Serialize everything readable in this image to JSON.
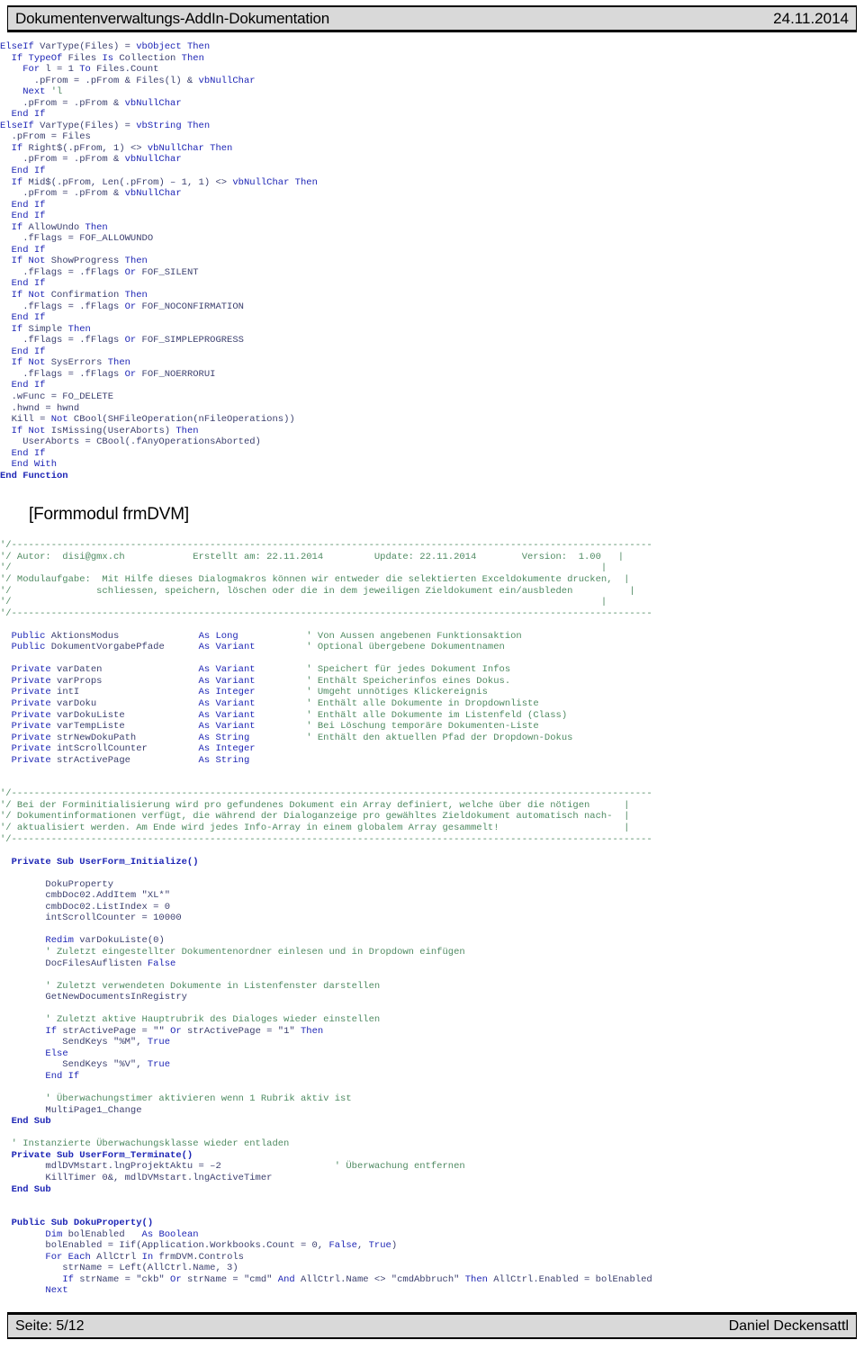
{
  "header": {
    "title": "Dokumentenverwaltungs-AddIn-Dokumentation",
    "date": "24.11.2014"
  },
  "footer": {
    "page_label": "Seite: 5/12",
    "author": "Daniel Deckensattl"
  },
  "section_title": "[Formmodul frmDVM]",
  "colors": {
    "keyword": "#1d25b5",
    "comment": "#4f8a62",
    "plain": "#3b3f6e",
    "chrome": "#d9d9d9"
  },
  "code_top": [
    {
      "t": "kw",
      "s": "ElseIf"
    },
    {
      "t": "pl",
      "s": " VarType(Files) = "
    },
    {
      "t": "kw",
      "s": "vbObject Then"
    },
    {
      "t": "nl"
    },
    {
      "t": "pl",
      "s": "  "
    },
    {
      "t": "kw",
      "s": "If TypeOf"
    },
    {
      "t": "pl",
      "s": " Files "
    },
    {
      "t": "kw",
      "s": "Is"
    },
    {
      "t": "pl",
      "s": " Collection "
    },
    {
      "t": "kw",
      "s": "Then"
    },
    {
      "t": "nl"
    },
    {
      "t": "pl",
      "s": "    "
    },
    {
      "t": "kw",
      "s": "For"
    },
    {
      "t": "pl",
      "s": " l = 1 "
    },
    {
      "t": "kw",
      "s": "To"
    },
    {
      "t": "pl",
      "s": " Files.Count"
    },
    {
      "t": "nl"
    },
    {
      "t": "pl",
      "s": "      .pFrom = .pFrom & Files(l) & "
    },
    {
      "t": "kw",
      "s": "vbNullChar"
    },
    {
      "t": "nl"
    },
    {
      "t": "pl",
      "s": "    "
    },
    {
      "t": "kw",
      "s": "Next"
    },
    {
      "t": "cm",
      "s": " 'l"
    },
    {
      "t": "nl"
    },
    {
      "t": "pl",
      "s": "    .pFrom = .pFrom & "
    },
    {
      "t": "kw",
      "s": "vbNullChar"
    },
    {
      "t": "nl"
    },
    {
      "t": "pl",
      "s": "  "
    },
    {
      "t": "kw",
      "s": "End If"
    },
    {
      "t": "nl"
    },
    {
      "t": "kw",
      "s": "ElseIf"
    },
    {
      "t": "pl",
      "s": " VarType(Files) = "
    },
    {
      "t": "kw",
      "s": "vbString Then"
    },
    {
      "t": "nl"
    },
    {
      "t": "pl",
      "s": "  .pFrom = Files"
    },
    {
      "t": "nl"
    },
    {
      "t": "pl",
      "s": "  "
    },
    {
      "t": "kw",
      "s": "If"
    },
    {
      "t": "pl",
      "s": " Right$(.pFrom, 1) <> "
    },
    {
      "t": "kw",
      "s": "vbNullChar Then"
    },
    {
      "t": "nl"
    },
    {
      "t": "pl",
      "s": "    .pFrom = .pFrom & "
    },
    {
      "t": "kw",
      "s": "vbNullChar"
    },
    {
      "t": "nl"
    },
    {
      "t": "pl",
      "s": "  "
    },
    {
      "t": "kw",
      "s": "End If"
    },
    {
      "t": "nl"
    },
    {
      "t": "pl",
      "s": "  "
    },
    {
      "t": "kw",
      "s": "If"
    },
    {
      "t": "pl",
      "s": " Mid$(.pFrom, Len(.pFrom) – 1, 1) <> "
    },
    {
      "t": "kw",
      "s": "vbNullChar Then"
    },
    {
      "t": "nl"
    },
    {
      "t": "pl",
      "s": "    .pFrom = .pFrom & "
    },
    {
      "t": "kw",
      "s": "vbNullChar"
    },
    {
      "t": "nl"
    },
    {
      "t": "pl",
      "s": "  "
    },
    {
      "t": "kw",
      "s": "End If"
    },
    {
      "t": "nl"
    },
    {
      "t": "pl",
      "s": "  "
    },
    {
      "t": "kw",
      "s": "End If"
    },
    {
      "t": "nl"
    },
    {
      "t": "pl",
      "s": "  "
    },
    {
      "t": "kw",
      "s": "If"
    },
    {
      "t": "pl",
      "s": " AllowUndo "
    },
    {
      "t": "kw",
      "s": "Then"
    },
    {
      "t": "nl"
    },
    {
      "t": "pl",
      "s": "    .fFlags = FOF_ALLOWUNDO"
    },
    {
      "t": "nl"
    },
    {
      "t": "pl",
      "s": "  "
    },
    {
      "t": "kw",
      "s": "End If"
    },
    {
      "t": "nl"
    },
    {
      "t": "pl",
      "s": "  "
    },
    {
      "t": "kw",
      "s": "If Not"
    },
    {
      "t": "pl",
      "s": " ShowProgress "
    },
    {
      "t": "kw",
      "s": "Then"
    },
    {
      "t": "nl"
    },
    {
      "t": "pl",
      "s": "    .fFlags = .fFlags "
    },
    {
      "t": "kw",
      "s": "Or"
    },
    {
      "t": "pl",
      "s": " FOF_SILENT"
    },
    {
      "t": "nl"
    },
    {
      "t": "pl",
      "s": "  "
    },
    {
      "t": "kw",
      "s": "End If"
    },
    {
      "t": "nl"
    },
    {
      "t": "pl",
      "s": "  "
    },
    {
      "t": "kw",
      "s": "If Not"
    },
    {
      "t": "pl",
      "s": " Confirmation "
    },
    {
      "t": "kw",
      "s": "Then"
    },
    {
      "t": "nl"
    },
    {
      "t": "pl",
      "s": "    .fFlags = .fFlags "
    },
    {
      "t": "kw",
      "s": "Or"
    },
    {
      "t": "pl",
      "s": " FOF_NOCONFIRMATION"
    },
    {
      "t": "nl"
    },
    {
      "t": "pl",
      "s": "  "
    },
    {
      "t": "kw",
      "s": "End If"
    },
    {
      "t": "nl"
    },
    {
      "t": "pl",
      "s": "  "
    },
    {
      "t": "kw",
      "s": "If"
    },
    {
      "t": "pl",
      "s": " Simple "
    },
    {
      "t": "kw",
      "s": "Then"
    },
    {
      "t": "nl"
    },
    {
      "t": "pl",
      "s": "    .fFlags = .fFlags "
    },
    {
      "t": "kw",
      "s": "Or"
    },
    {
      "t": "pl",
      "s": " FOF_SIMPLEPROGRESS"
    },
    {
      "t": "nl"
    },
    {
      "t": "pl",
      "s": "  "
    },
    {
      "t": "kw",
      "s": "End If"
    },
    {
      "t": "nl"
    },
    {
      "t": "pl",
      "s": "  "
    },
    {
      "t": "kw",
      "s": "If Not"
    },
    {
      "t": "pl",
      "s": " SysErrors "
    },
    {
      "t": "kw",
      "s": "Then"
    },
    {
      "t": "nl"
    },
    {
      "t": "pl",
      "s": "    .fFlags = .fFlags "
    },
    {
      "t": "kw",
      "s": "Or"
    },
    {
      "t": "pl",
      "s": " FOF_NOERRORUI"
    },
    {
      "t": "nl"
    },
    {
      "t": "pl",
      "s": "  "
    },
    {
      "t": "kw",
      "s": "End If"
    },
    {
      "t": "nl"
    },
    {
      "t": "pl",
      "s": "  .wFunc = FO_DELETE"
    },
    {
      "t": "nl"
    },
    {
      "t": "pl",
      "s": "  .hwnd = hwnd"
    },
    {
      "t": "nl"
    },
    {
      "t": "pl",
      "s": "  Kill = "
    },
    {
      "t": "kw",
      "s": "Not"
    },
    {
      "t": "pl",
      "s": " CBool(SHFileOperation(nFileOperations))"
    },
    {
      "t": "nl"
    },
    {
      "t": "pl",
      "s": "  "
    },
    {
      "t": "kw",
      "s": "If Not"
    },
    {
      "t": "pl",
      "s": " IsMissing(UserAborts) "
    },
    {
      "t": "kw",
      "s": "Then"
    },
    {
      "t": "nl"
    },
    {
      "t": "pl",
      "s": "    UserAborts = CBool(.fAnyOperationsAborted)"
    },
    {
      "t": "nl"
    },
    {
      "t": "pl",
      "s": "  "
    },
    {
      "t": "kw",
      "s": "End If"
    },
    {
      "t": "nl"
    },
    {
      "t": "pl",
      "s": "  "
    },
    {
      "t": "kw",
      "s": "End With"
    },
    {
      "t": "nl"
    },
    {
      "t": "bd",
      "s": "End Function"
    }
  ],
  "code_mid": [
    {
      "t": "cm",
      "s": "'/-----------------------------------------------------------------------------------------------------------------"
    },
    {
      "t": "nl"
    },
    {
      "t": "cm",
      "s": "'/ Autor:  disi@gmx.ch            Erstellt am: 22.11.2014         Update: 22.11.2014        Version:  1.00   |"
    },
    {
      "t": "nl"
    },
    {
      "t": "cm",
      "s": "'/                                                                                                        |"
    },
    {
      "t": "nl"
    },
    {
      "t": "cm",
      "s": "'/ Modulaufgabe:  Mit Hilfe dieses Dialogmakros können wir entweder die selektierten Exceldokumente drucken,  |"
    },
    {
      "t": "nl"
    },
    {
      "t": "cm",
      "s": "'/               schliessen, speichern, löschen oder die in dem jeweiligen Zieldokument ein/ausbleden          |"
    },
    {
      "t": "nl"
    },
    {
      "t": "cm",
      "s": "'/                                                                                                        |"
    },
    {
      "t": "nl"
    },
    {
      "t": "cm",
      "s": "'/-----------------------------------------------------------------------------------------------------------------"
    },
    {
      "t": "nl"
    },
    {
      "t": "nl"
    },
    {
      "t": "kw",
      "s": "  Public"
    },
    {
      "t": "pl",
      "s": " AktionsModus              "
    },
    {
      "t": "kw",
      "s": "As Long"
    },
    {
      "t": "pl",
      "s": "            "
    },
    {
      "t": "cm",
      "s": "' Von Aussen angebenen Funktionsaktion"
    },
    {
      "t": "nl"
    },
    {
      "t": "kw",
      "s": "  Public"
    },
    {
      "t": "pl",
      "s": " DokumentVorgabePfade      "
    },
    {
      "t": "kw",
      "s": "As Variant"
    },
    {
      "t": "pl",
      "s": "         "
    },
    {
      "t": "cm",
      "s": "' Optional übergebene Dokumentnamen"
    },
    {
      "t": "nl"
    },
    {
      "t": "nl"
    },
    {
      "t": "kw",
      "s": "  Private"
    },
    {
      "t": "pl",
      "s": " varDaten                 "
    },
    {
      "t": "kw",
      "s": "As Variant"
    },
    {
      "t": "pl",
      "s": "         "
    },
    {
      "t": "cm",
      "s": "' Speichert für jedes Dokument Infos"
    },
    {
      "t": "nl"
    },
    {
      "t": "kw",
      "s": "  Private"
    },
    {
      "t": "pl",
      "s": " varProps                 "
    },
    {
      "t": "kw",
      "s": "As Variant"
    },
    {
      "t": "pl",
      "s": "         "
    },
    {
      "t": "cm",
      "s": "' Enthält Speicherinfos eines Dokus."
    },
    {
      "t": "nl"
    },
    {
      "t": "kw",
      "s": "  Private"
    },
    {
      "t": "pl",
      "s": " intI                     "
    },
    {
      "t": "kw",
      "s": "As Integer"
    },
    {
      "t": "pl",
      "s": "         "
    },
    {
      "t": "cm",
      "s": "' Umgeht unnötiges Klickereignis"
    },
    {
      "t": "nl"
    },
    {
      "t": "kw",
      "s": "  Private"
    },
    {
      "t": "pl",
      "s": " varDoku                  "
    },
    {
      "t": "kw",
      "s": "As Variant"
    },
    {
      "t": "pl",
      "s": "         "
    },
    {
      "t": "cm",
      "s": "' Enthält alle Dokumente in Dropdownliste"
    },
    {
      "t": "nl"
    },
    {
      "t": "kw",
      "s": "  Private"
    },
    {
      "t": "pl",
      "s": " varDokuListe             "
    },
    {
      "t": "kw",
      "s": "As Variant"
    },
    {
      "t": "pl",
      "s": "         "
    },
    {
      "t": "cm",
      "s": "' Enthält alle Dokumente im Listenfeld (Class)"
    },
    {
      "t": "nl"
    },
    {
      "t": "kw",
      "s": "  Private"
    },
    {
      "t": "pl",
      "s": " varTempListe             "
    },
    {
      "t": "kw",
      "s": "As Variant"
    },
    {
      "t": "pl",
      "s": "         "
    },
    {
      "t": "cm",
      "s": "' Bei Löschung temporäre Dokumenten-Liste"
    },
    {
      "t": "nl"
    },
    {
      "t": "kw",
      "s": "  Private"
    },
    {
      "t": "pl",
      "s": " strNewDokuPath           "
    },
    {
      "t": "kw",
      "s": "As String"
    },
    {
      "t": "pl",
      "s": "          "
    },
    {
      "t": "cm",
      "s": "' Enthält den aktuellen Pfad der Dropdown-Dokus"
    },
    {
      "t": "nl"
    },
    {
      "t": "kw",
      "s": "  Private"
    },
    {
      "t": "pl",
      "s": " intScrollCounter         "
    },
    {
      "t": "kw",
      "s": "As Integer"
    },
    {
      "t": "nl"
    },
    {
      "t": "kw",
      "s": "  Private"
    },
    {
      "t": "pl",
      "s": " strActivePage            "
    },
    {
      "t": "kw",
      "s": "As String"
    },
    {
      "t": "nl"
    },
    {
      "t": "nl"
    },
    {
      "t": "nl"
    },
    {
      "t": "cm",
      "s": "'/-----------------------------------------------------------------------------------------------------------------"
    },
    {
      "t": "nl"
    },
    {
      "t": "cm",
      "s": "'/ Bei der Forminitialisierung wird pro gefundenes Dokument ein Array definiert, welche über die nötigen      |"
    },
    {
      "t": "nl"
    },
    {
      "t": "cm",
      "s": "'/ Dokumentinformationen verfügt, die während der Dialoganzeige pro gewähltes Zieldokument automatisch nach-  |"
    },
    {
      "t": "nl"
    },
    {
      "t": "cm",
      "s": "'/ aktualisiert werden. Am Ende wird jedes Info-Array in einem globalem Array gesammelt!                      |"
    },
    {
      "t": "nl"
    },
    {
      "t": "cm",
      "s": "'/-----------------------------------------------------------------------------------------------------------------"
    },
    {
      "t": "nl"
    },
    {
      "t": "nl"
    },
    {
      "t": "bd",
      "s": "  Private Sub UserForm_Initialize()"
    },
    {
      "t": "nl"
    },
    {
      "t": "nl"
    },
    {
      "t": "pl",
      "s": "        DokuProperty"
    },
    {
      "t": "nl"
    },
    {
      "t": "pl",
      "s": "        cmbDoc02.AddItem \"XL*\""
    },
    {
      "t": "nl"
    },
    {
      "t": "pl",
      "s": "        cmbDoc02.ListIndex = 0"
    },
    {
      "t": "nl"
    },
    {
      "t": "pl",
      "s": "        intScrollCounter = 10000"
    },
    {
      "t": "nl"
    },
    {
      "t": "nl"
    },
    {
      "t": "pl",
      "s": "        "
    },
    {
      "t": "kw",
      "s": "Redim"
    },
    {
      "t": "pl",
      "s": " varDokuListe(0)"
    },
    {
      "t": "nl"
    },
    {
      "t": "cm",
      "s": "        ' Zuletzt eingestellter Dokumentenordner einlesen und in Dropdown einfügen"
    },
    {
      "t": "nl"
    },
    {
      "t": "pl",
      "s": "        DocFilesAuflisten "
    },
    {
      "t": "kw",
      "s": "False"
    },
    {
      "t": "nl"
    },
    {
      "t": "nl"
    },
    {
      "t": "cm",
      "s": "        ' Zuletzt verwendeten Dokumente in Listenfenster darstellen"
    },
    {
      "t": "nl"
    },
    {
      "t": "pl",
      "s": "        GetNewDocumentsInRegistry"
    },
    {
      "t": "nl"
    },
    {
      "t": "nl"
    },
    {
      "t": "cm",
      "s": "        ' Zuletzt aktive Hauptrubrik des Dialoges wieder einstellen"
    },
    {
      "t": "nl"
    },
    {
      "t": "pl",
      "s": "        "
    },
    {
      "t": "kw",
      "s": "If"
    },
    {
      "t": "pl",
      "s": " strActivePage = \"\" "
    },
    {
      "t": "kw",
      "s": "Or"
    },
    {
      "t": "pl",
      "s": " strActivePage = \"1\" "
    },
    {
      "t": "kw",
      "s": "Then"
    },
    {
      "t": "nl"
    },
    {
      "t": "pl",
      "s": "           SendKeys \"%M\", "
    },
    {
      "t": "kw",
      "s": "True"
    },
    {
      "t": "nl"
    },
    {
      "t": "pl",
      "s": "        "
    },
    {
      "t": "kw",
      "s": "Else"
    },
    {
      "t": "nl"
    },
    {
      "t": "pl",
      "s": "           SendKeys \"%V\", "
    },
    {
      "t": "kw",
      "s": "True"
    },
    {
      "t": "nl"
    },
    {
      "t": "pl",
      "s": "        "
    },
    {
      "t": "kw",
      "s": "End If"
    },
    {
      "t": "nl"
    },
    {
      "t": "nl"
    },
    {
      "t": "cm",
      "s": "        ' Überwachungstimer aktivieren wenn 1 Rubrik aktiv ist"
    },
    {
      "t": "nl"
    },
    {
      "t": "pl",
      "s": "        MultiPage1_Change"
    },
    {
      "t": "nl"
    },
    {
      "t": "bd",
      "s": "  End Sub"
    },
    {
      "t": "nl"
    },
    {
      "t": "nl"
    },
    {
      "t": "cm",
      "s": "  ' Instanzierte Überwachungsklasse wieder entladen"
    },
    {
      "t": "nl"
    },
    {
      "t": "bd",
      "s": "  Private Sub UserForm_Terminate()"
    },
    {
      "t": "nl"
    },
    {
      "t": "pl",
      "s": "        mdlDVMstart.lngProjektAktu = –2                    "
    },
    {
      "t": "cm",
      "s": "' Überwachung entfernen"
    },
    {
      "t": "nl"
    },
    {
      "t": "pl",
      "s": "        KillTimer 0&, mdlDVMstart.lngActiveTimer"
    },
    {
      "t": "nl"
    },
    {
      "t": "bd",
      "s": "  End Sub"
    },
    {
      "t": "nl"
    },
    {
      "t": "nl"
    },
    {
      "t": "nl"
    },
    {
      "t": "bd",
      "s": "  Public Sub DokuProperty()"
    },
    {
      "t": "nl"
    },
    {
      "t": "pl",
      "s": "        "
    },
    {
      "t": "kw",
      "s": "Dim"
    },
    {
      "t": "pl",
      "s": " bolEnabled   "
    },
    {
      "t": "kw",
      "s": "As Boolean"
    },
    {
      "t": "nl"
    },
    {
      "t": "pl",
      "s": "        bolEnabled = Iif(Application.Workbooks.Count = 0, "
    },
    {
      "t": "kw",
      "s": "False"
    },
    {
      "t": "pl",
      "s": ", "
    },
    {
      "t": "kw",
      "s": "True"
    },
    {
      "t": "pl",
      "s": ")"
    },
    {
      "t": "nl"
    },
    {
      "t": "pl",
      "s": "        "
    },
    {
      "t": "kw",
      "s": "For Each"
    },
    {
      "t": "pl",
      "s": " AllCtrl "
    },
    {
      "t": "kw",
      "s": "In"
    },
    {
      "t": "pl",
      "s": " frmDVM.Controls"
    },
    {
      "t": "nl"
    },
    {
      "t": "pl",
      "s": "           strName = Left(AllCtrl.Name, 3)"
    },
    {
      "t": "nl"
    },
    {
      "t": "pl",
      "s": "           "
    },
    {
      "t": "kw",
      "s": "If"
    },
    {
      "t": "pl",
      "s": " strName = \"ckb\" "
    },
    {
      "t": "kw",
      "s": "Or"
    },
    {
      "t": "pl",
      "s": " strName = \"cmd\" "
    },
    {
      "t": "kw",
      "s": "And"
    },
    {
      "t": "pl",
      "s": " AllCtrl.Name <> \"cmdAbbruch\" "
    },
    {
      "t": "kw",
      "s": "Then"
    },
    {
      "t": "pl",
      "s": " AllCtrl.Enabled = bolEnabled"
    },
    {
      "t": "nl"
    },
    {
      "t": "pl",
      "s": "        "
    },
    {
      "t": "kw",
      "s": "Next"
    }
  ]
}
